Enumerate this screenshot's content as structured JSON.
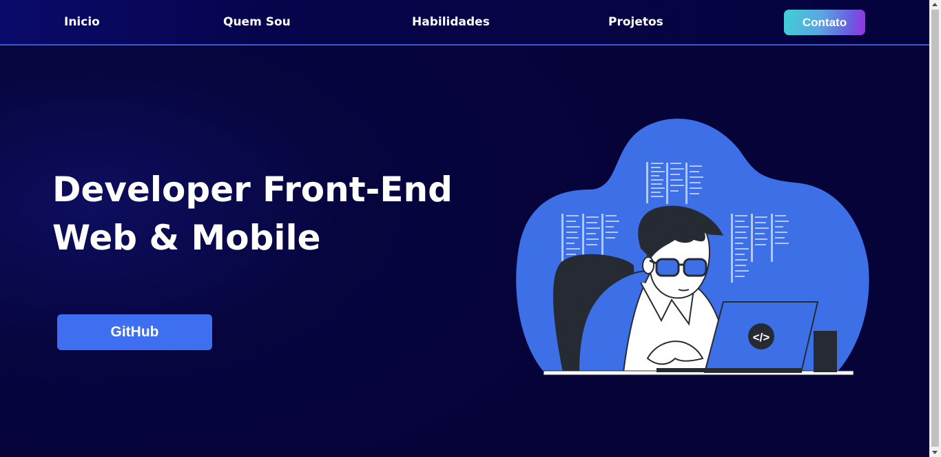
{
  "nav": {
    "items": [
      {
        "label": "Inicio"
      },
      {
        "label": "Quem Sou"
      },
      {
        "label": "Habilidades"
      },
      {
        "label": "Projetos"
      }
    ],
    "contact_label": "Contato"
  },
  "hero": {
    "title_line1": "Developer Front-End",
    "title_line2": "Web & Mobile",
    "github_label": "GitHub"
  },
  "illustration": {
    "subject": "developer-at-laptop",
    "code_symbol": "</>"
  },
  "colors": {
    "background": "#05033a",
    "accent_blue": "#3d6ff0",
    "nav_border": "#3a5bd9",
    "contact_gradient_start": "#3fd0d6",
    "contact_gradient_end": "#9b2fe2"
  }
}
